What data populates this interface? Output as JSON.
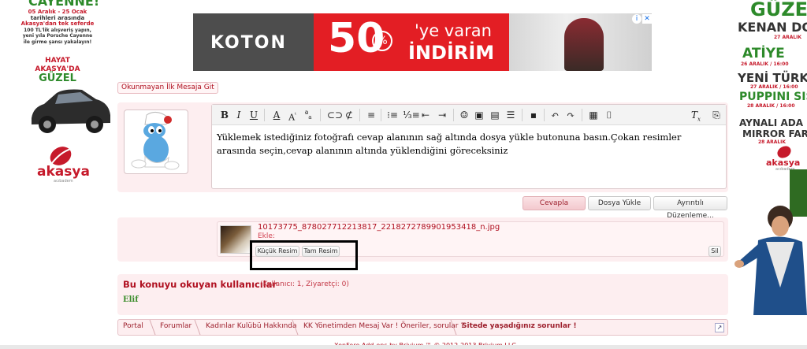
{
  "left_ad": {
    "headline": "CAYENNE!",
    "body_lines": [
      "05 Aralık - 25 Ocak",
      "tarihleri arasında",
      "Akasya'dan tek seferde",
      "100 TL'lik alışveriş yapın,",
      "yeni yıla Porsche Cayenne",
      "ile girme şansı yakalayın!"
    ],
    "slogan_lines": [
      "HAYAT",
      "AKASYA'DA",
      "GÜZEL"
    ],
    "brand": "akasya",
    "brand_sub": "acıbadem"
  },
  "right_ad": {
    "headline": "GÜZE",
    "lines": [
      "KENAN DO",
      "27 ARALIK",
      "ATİYE",
      "26 ARALIK / 16:00",
      "YENİ TÜRK",
      "27 ARALIK / 16:00",
      "PUPPINI SIS",
      "28 ARALIK / 16:00",
      "AYNALI ADA",
      "MIRROR FAR",
      "28 ARALIK"
    ],
    "brand": "akasya",
    "brand_sub": "acıbadem"
  },
  "banner": {
    "brand": "KOTON",
    "number": "50",
    "percent": "%",
    "tagline": "'ye varan",
    "indirim": "İNDİRİM",
    "info_icon": "info-icon",
    "close_icon": "close-icon"
  },
  "unread_button": "Okunmayan İlk Mesaja Git",
  "editor": {
    "toolbar_icons": [
      "bold",
      "italic",
      "underline",
      "text-color",
      "font-size",
      "font-family",
      "link",
      "unlink",
      "align",
      "bullet-list",
      "number-list",
      "outdent",
      "indent",
      "smilies",
      "image",
      "media",
      "code",
      "save-draft",
      "undo",
      "redo",
      "bbcode",
      "camera",
      "remove-format",
      "restore-draft"
    ],
    "content": "Yüklemek istediğiniz fotoğrafı cevap alanının sağ altında dosya yükle butonuna basın.Çokan resimler arasında seçin,cevap alanının altında yüklendiğini göreceksiniz"
  },
  "actions": {
    "reply": "Cevapla",
    "upload": "Dosya Yükle",
    "advanced": "Ayrıntılı Düzenleme..."
  },
  "attachment": {
    "filename": "10173775_878027712213817_2218272789901953418_n.jpg",
    "label": "Ekle:",
    "thumbnail_button": "Küçük Resim",
    "full_button": "Tam Resim",
    "delete_button": "Sil"
  },
  "readers": {
    "title": "Bu konuyu okuyan kullanıcılar",
    "count": "(Kullanıcı: 1, Ziyaretçi: 0)",
    "user": "Elif"
  },
  "breadcrumb": [
    "Portal",
    "Forumlar",
    "Kadınlar Kulübü Hakkında",
    "KK Yönetimden Mesaj Var ! Öneriler, sorular ?",
    "Sitede yaşadığınız sorunlar !"
  ],
  "footer": "XenForo Add-ons by Brivium ™ © 2012-2013 Brivium LLC.",
  "colors": {
    "accent": "#b01020",
    "panel": "#fdeef0",
    "banner_red": "#e31e24",
    "user_green": "#3a8c2a"
  }
}
